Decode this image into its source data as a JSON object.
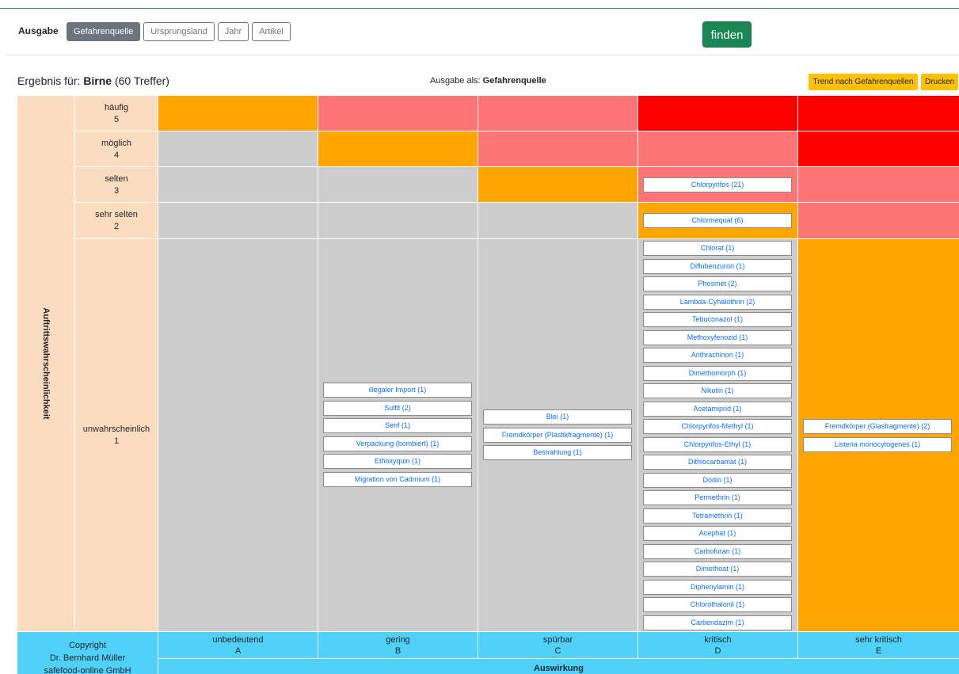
{
  "toolbar": {
    "label": "Ausgabe",
    "buttons": [
      "Gefahrenquelle",
      "Ursprungsland",
      "Jahr",
      "Artikel"
    ],
    "active": "Gefahrenquelle",
    "find_label": "finden"
  },
  "result": {
    "prefix": "Ergebnis für:",
    "product": "Birne",
    "count": "(60 Treffer)",
    "output_prefix": "Ausgabe als:",
    "output_value": "Gefahrenquelle",
    "trend_button": "Trend nach Gefahrenquellen",
    "print_button": "Drucken"
  },
  "matrix": {
    "y_axis_label": "Auftrittswahrscheinlichkeit",
    "rows": [
      {
        "name": "häufig",
        "code": "5"
      },
      {
        "name": "möglich",
        "code": "4"
      },
      {
        "name": "selten",
        "code": "3"
      },
      {
        "name": "sehr selten",
        "code": "2"
      },
      {
        "name": "unwahrscheinlich",
        "code": "1"
      }
    ],
    "columns": [
      {
        "name": "unbedeutend",
        "code": "A"
      },
      {
        "name": "gering",
        "code": "B"
      },
      {
        "name": "spürbar",
        "code": "C"
      },
      {
        "name": "kritisch",
        "code": "D"
      },
      {
        "name": "sehr kritisch",
        "code": "E"
      }
    ],
    "x_axis_label": "Auswirkung",
    "copyright": [
      "Copyright",
      "Dr. Bernhard Müller",
      "safefood-online GmbH"
    ],
    "colors": {
      "orange": "#ffa500",
      "salmon": "#ff7575",
      "red": "#ff0000",
      "gray": "#cccccc",
      "peach": "#fcdcbe",
      "blue": "#4fd1fa"
    },
    "cell_colors": [
      [
        "orange",
        "salmon",
        "salmon",
        "red",
        "red"
      ],
      [
        "gray",
        "orange",
        "salmon",
        "salmon",
        "red"
      ],
      [
        "gray",
        "gray",
        "orange",
        "salmon",
        "salmon"
      ],
      [
        "gray",
        "gray",
        "gray",
        "orange",
        "salmon"
      ],
      [
        "gray",
        "gray",
        "gray",
        "gray",
        "orange"
      ]
    ],
    "items": {
      "selten_kritisch": [
        "Chlorpyrifos (21)"
      ],
      "sehr_selten_kritisch": [
        "Chlormequat (6)"
      ],
      "unwahrscheinlich_gering": [
        "illegaler Import (1)",
        "Sulfit (2)",
        "Senf (1)",
        "Verpackung (bombiert) (1)",
        "Ethoxyquin (1)",
        "Migration von Cadmium (1)"
      ],
      "unwahrscheinlich_spuerbar": [
        "Blei (1)",
        "Fremdkörper (Plastikfragmente) (1)",
        "Bestrahlung (1)"
      ],
      "unwahrscheinlich_kritisch": [
        "Chlorat (1)",
        "Diflubenzuron (1)",
        "Phosmet (2)",
        "Lambda-Cyhalothrin (2)",
        "Tebuconazol (1)",
        "Methoxyfenozid (1)",
        "Anthrachinon (1)",
        "Dimethomorph (1)",
        "Nikotin (1)",
        "Acetamiprid (1)",
        "Chlorpyrifos-Methyl (1)",
        "Chlorpyrifos-Ethyl (1)",
        "Dithiocarbamat (1)",
        "Dodin (1)",
        "Permethrin (1)",
        "Tetramethrin (1)",
        "Acephat (1)",
        "Carbofuran (1)",
        "Dimethoat (1)",
        "Diphenylamin (1)",
        "Chlorothalonil (1)",
        "Carbendazim (1)"
      ],
      "unwahrscheinlich_sehr_kritisch": [
        "Fremdkörper (Glasfragmente) (2)",
        "Listeria monocytogenes (1)"
      ]
    }
  }
}
